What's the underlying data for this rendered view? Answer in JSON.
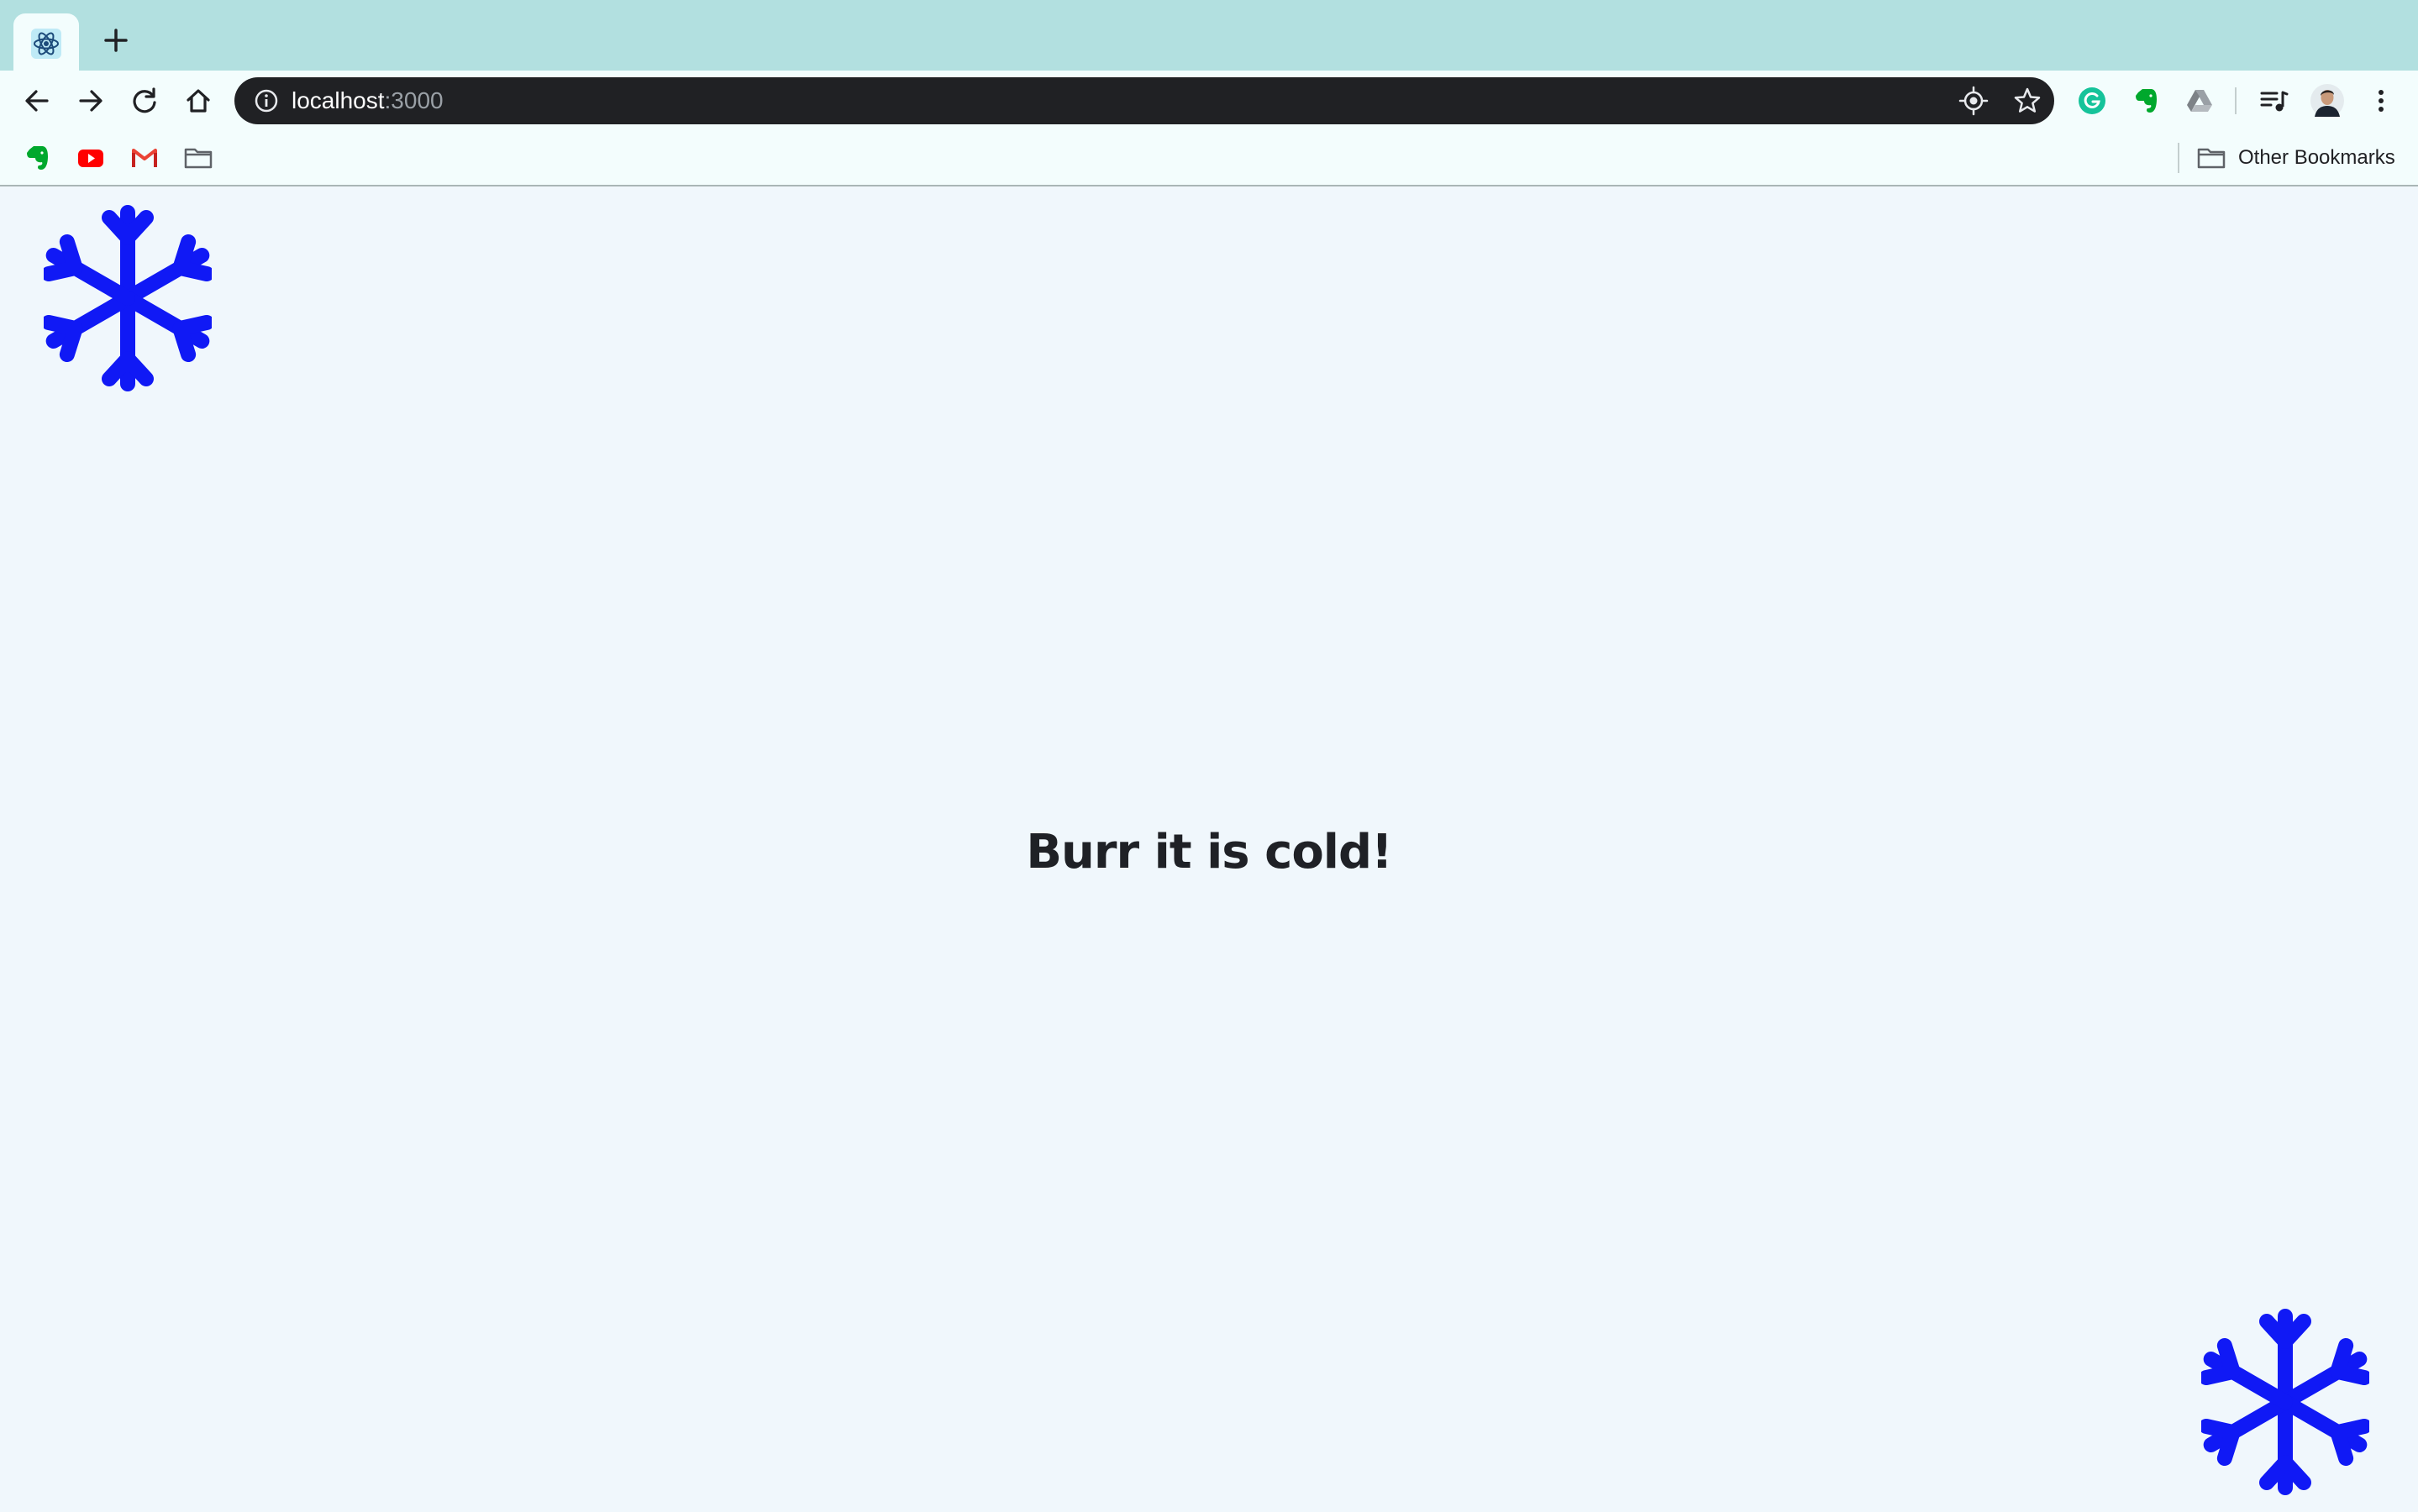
{
  "browser": {
    "url_host": "localhost",
    "url_port": ":3000",
    "bookmarks": {
      "other_label": "Other Bookmarks"
    },
    "icons": {
      "tab_favicon": "react-atom-icon",
      "new_tab": "plus-icon",
      "back": "arrow-left-icon",
      "forward": "arrow-right-icon",
      "reload": "reload-icon",
      "home": "home-icon",
      "site_info": "info-icon",
      "location": "location-icon",
      "bookmark_star": "star-icon",
      "extensions": [
        "grammarly-icon",
        "evernote-icon",
        "google-drive-icon",
        "media-queue-icon"
      ],
      "profile": "avatar",
      "menu": "more-vertical-icon",
      "bookmark_items": [
        "evernote-icon",
        "youtube-icon",
        "gmail-icon",
        "folder-icon"
      ]
    }
  },
  "page": {
    "heading": "Burr it is cold!",
    "snowflake_color": "#1019f5",
    "background_color": "#f0f7fc"
  }
}
